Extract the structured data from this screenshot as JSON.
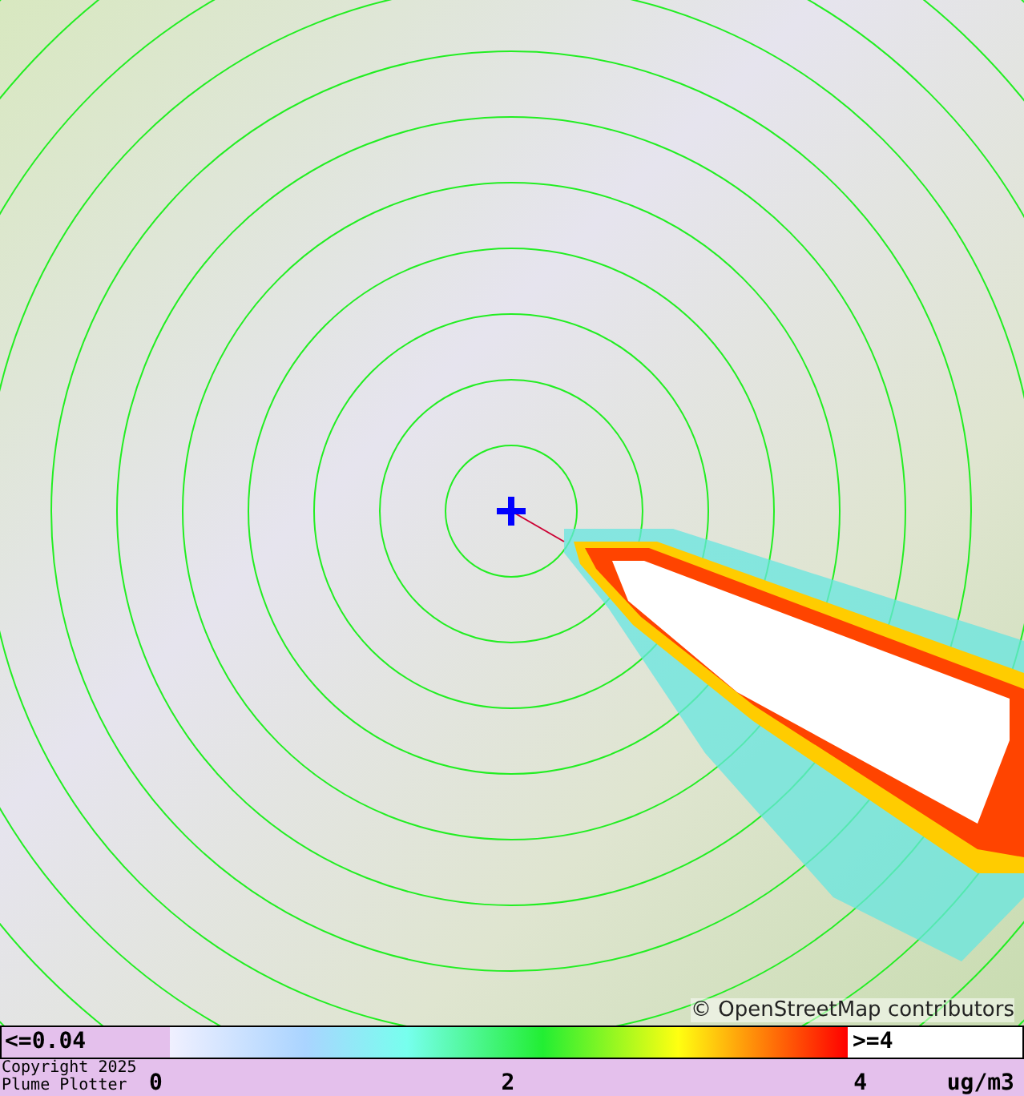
{
  "map": {
    "attribution": "© OpenStreetMap contributors"
  },
  "legend": {
    "min_label": "<=0.04",
    "max_label": ">=4",
    "ticks": [
      "0",
      "2",
      "4"
    ],
    "unit": "ug/m3"
  },
  "copyright": [
    "Copyright 2025",
    "Plume Plotter"
  ]
}
